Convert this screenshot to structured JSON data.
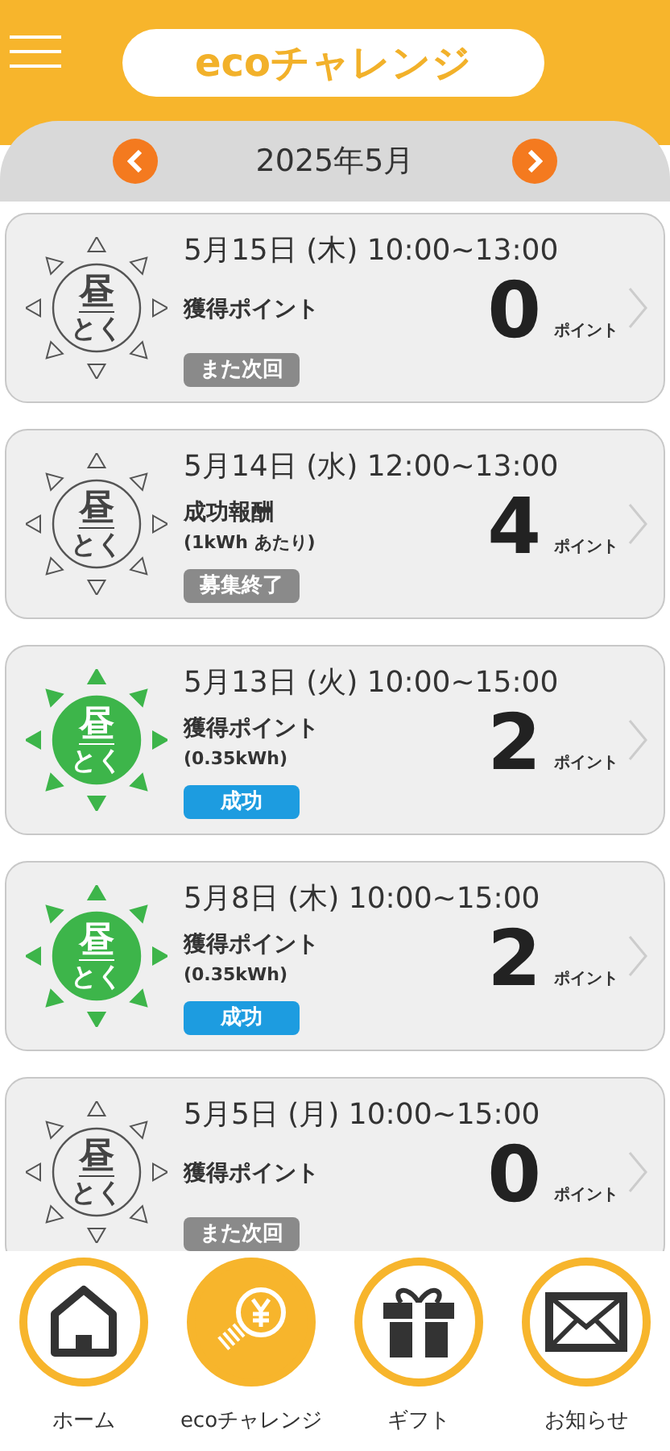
{
  "header": {
    "title": "ecoチャレンジ"
  },
  "month_nav": {
    "label": "2025年5月"
  },
  "events": [
    {
      "date": "5月15日 (木) 10:00~13:00",
      "icon_top": "昼",
      "icon_bottom": "とく",
      "achieved": false,
      "label": "獲得ポイント",
      "points": "0",
      "unit": "ポイント",
      "status": {
        "label": "また次回",
        "kind": "neutral"
      }
    },
    {
      "date": "5月14日 (水) 12:00~13:00",
      "icon_top": "昼",
      "icon_bottom": "とく",
      "achieved": false,
      "label": "成功報酬",
      "sub": "(1kWh あたり)",
      "points": "4",
      "unit": "ポイント",
      "status": {
        "label": "募集終了",
        "kind": "neutral"
      }
    },
    {
      "date": "5月13日 (火) 10:00~15:00",
      "icon_top": "昼",
      "icon_bottom": "とく",
      "achieved": true,
      "label": "獲得ポイント",
      "sub": "(0.35kWh)",
      "points": "2",
      "unit": "ポイント",
      "status": {
        "label": "成功",
        "kind": "success"
      }
    },
    {
      "date": "5月8日 (木) 10:00~15:00",
      "icon_top": "昼",
      "icon_bottom": "とく",
      "achieved": true,
      "label": "獲得ポイント",
      "sub": "(0.35kWh)",
      "points": "2",
      "unit": "ポイント",
      "status": {
        "label": "成功",
        "kind": "success"
      }
    },
    {
      "date": "5月5日 (月) 10:00~15:00",
      "icon_top": "昼",
      "icon_bottom": "とく",
      "achieved": false,
      "label": "獲得ポイント",
      "points": "0",
      "unit": "ポイント",
      "status": {
        "label": "また次回",
        "kind": "neutral"
      }
    }
  ],
  "bottom_nav": [
    {
      "label": "ホーム",
      "kind": "home",
      "selected": false
    },
    {
      "label": "ecoチャレンジ",
      "kind": "eco",
      "selected": true
    },
    {
      "label": "ギフト",
      "kind": "gift",
      "selected": false
    },
    {
      "label": "お知らせ",
      "kind": "mail",
      "selected": false
    }
  ]
}
